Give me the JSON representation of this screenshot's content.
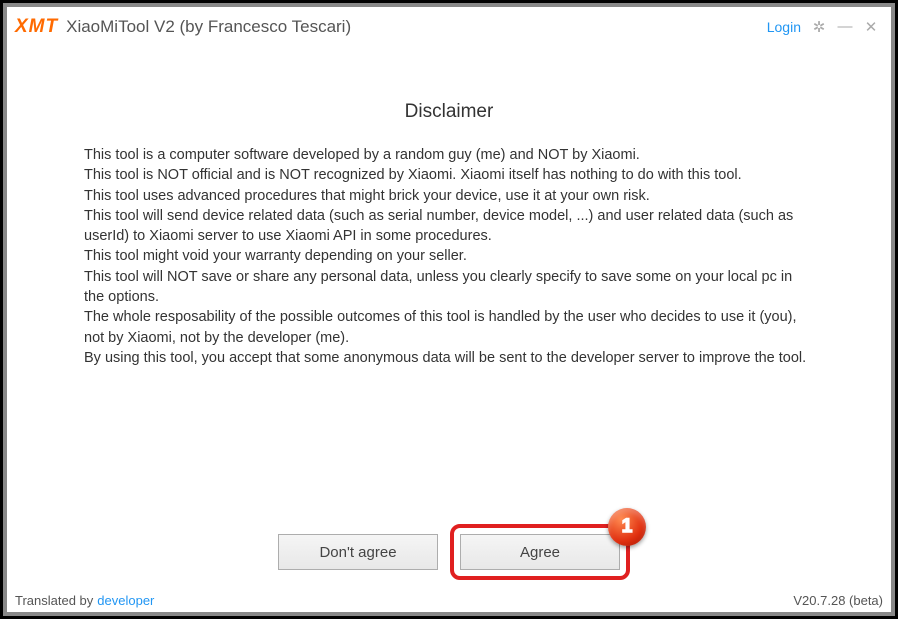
{
  "header": {
    "logo": "XMT",
    "title": "XiaoMiTool V2 (by Francesco Tescari)",
    "login": "Login"
  },
  "dialog": {
    "heading": "Disclaimer",
    "body": "This tool is a computer software developed by a random guy (me) and NOT by Xiaomi.\nThis tool is NOT official and is NOT recognized by Xiaomi. Xiaomi itself has nothing to do with this tool.\nThis tool uses advanced procedures that might brick your device, use it at your own risk.\nThis tool will send device related data (such as serial number, device model, ...) and user related data (such as userId) to Xiaomi server to use Xiaomi API in some procedures.\nThis tool might void your warranty depending on your seller.\nThis tool will NOT save or share any personal data, unless you clearly specify to save some on your local pc in the options.\nThe whole resposability of the possible outcomes of this tool is handled by the user who decides to use it (you), not by Xiaomi, not by the developer (me).\nBy using this tool, you accept that some anonymous data will be sent to the developer server to improve the tool.",
    "dontAgree": "Don't agree",
    "agree": "Agree"
  },
  "annotation": {
    "badge": "1"
  },
  "footer": {
    "translatedBy": "Translated by",
    "developer": "developer",
    "version": "V20.7.28 (beta)"
  }
}
